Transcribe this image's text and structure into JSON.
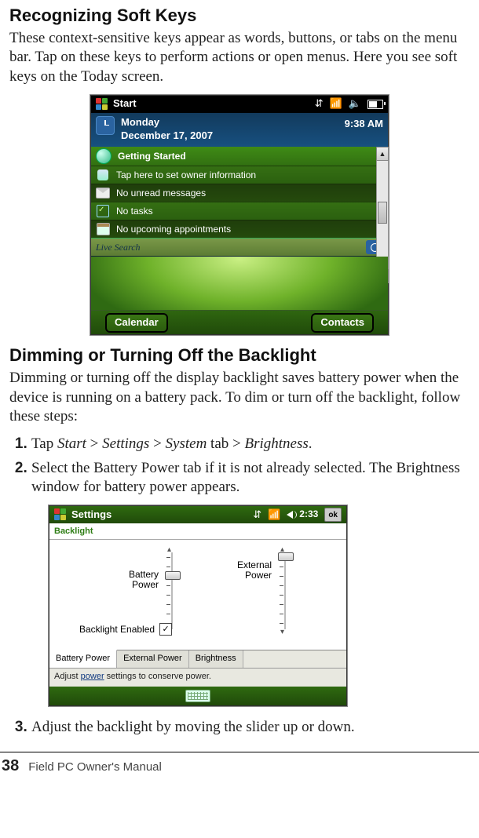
{
  "section1": {
    "heading": "Recognizing Soft Keys",
    "para": "These context-sensitive keys appear as words, buttons, or tabs on the menu bar. Tap on these keys to perform actions or open menus. Here you see soft keys on the Today screen."
  },
  "today": {
    "start": "Start",
    "day": "Monday",
    "date": "December 17, 2007",
    "time": "9:38 AM",
    "getting_started": "Getting Started",
    "rows": {
      "owner": "Tap here to set owner information",
      "messages": "No unread messages",
      "tasks": "No tasks",
      "appointments": "No upcoming appointments"
    },
    "live_search": "Live Search",
    "softkeys": {
      "left": "Calendar",
      "right": "Contacts"
    }
  },
  "section2": {
    "heading": "Dimming or Turning Off the Backlight",
    "para": "Dimming or turning off the display backlight saves battery power when the device is running on a battery pack. To dim or turn off the backlight, follow these steps:",
    "steps": {
      "s1_pre": "Tap ",
      "s1_start": "Start",
      "s1_gt1": " > ",
      "s1_settings": "Settings",
      "s1_gt2": " > ",
      "s1_system": "System",
      "s1_tab": " tab > ",
      "s1_brightness": "Brightness",
      "s1_end": ".",
      "s2": "Select the Battery Power tab if it is not already selected. The Brightness window for battery power appears.",
      "s3": "Adjust the backlight by moving the slider up or down."
    }
  },
  "settings": {
    "title": "Settings",
    "time": "2:33",
    "ok": "ok",
    "subtitle": "Backlight",
    "slider_battery": "Battery Power",
    "slider_external": "External Power",
    "checkbox_label": "Backlight Enabled",
    "tabs": {
      "t1": "Battery Power",
      "t2": "External Power",
      "t3": "Brightness"
    },
    "tip_pre": "Adjust ",
    "tip_link": "power",
    "tip_post": " settings to conserve power."
  },
  "footer": {
    "page": "38",
    "label": "Field PC Owner's Manual"
  }
}
